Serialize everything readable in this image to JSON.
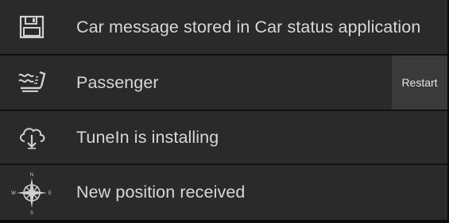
{
  "notifications": [
    {
      "icon": "floppy-disk-icon",
      "text": "Car message stored in Car status application"
    },
    {
      "icon": "seat-heater-icon",
      "text": "Passenger",
      "action_label": "Restart"
    },
    {
      "icon": "cloud-download-icon",
      "text": "TuneIn is installing"
    },
    {
      "icon": "compass-icon",
      "text": "New position received"
    }
  ],
  "compass_letters": {
    "n": "N",
    "s": "S",
    "e": "E",
    "w": "W"
  },
  "colors": {
    "row_background": "#2a2a2a",
    "separator": "#111111",
    "text": "#d7d7d7",
    "action_background": "#3a3a3a"
  }
}
